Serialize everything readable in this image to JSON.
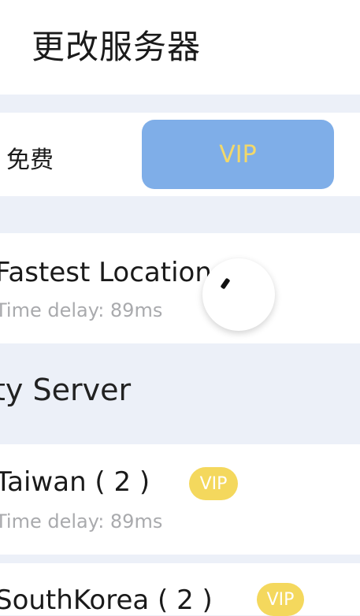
{
  "header": {
    "title": "更改服务器"
  },
  "tabs": {
    "free_label": "免费",
    "vip_label": "VIP"
  },
  "fastest": {
    "title": "Fastest Location",
    "delay": "Time delay: 89ms"
  },
  "section": {
    "title": "ty Server"
  },
  "servers": [
    {
      "name": "Taiwan ( 2 )",
      "badge": "VIP",
      "delay": "Time delay: 89ms"
    },
    {
      "name": "SouthKorea ( 2 )",
      "badge": "VIP"
    }
  ],
  "colors": {
    "accent_blue": "#7faee8",
    "vip_yellow": "#f4d85d",
    "tab_vip_text": "#f2d86a",
    "page_bg": "#ecf0f8"
  },
  "icons": {
    "fab": "pointer-icon"
  }
}
